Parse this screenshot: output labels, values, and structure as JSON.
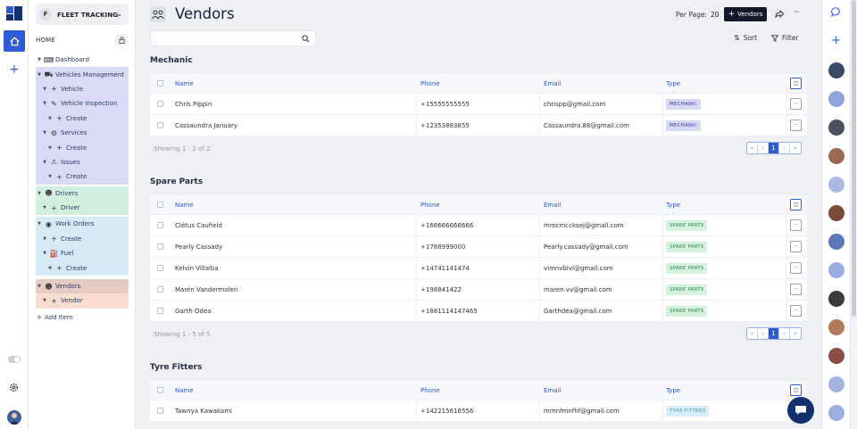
{
  "app": {
    "badge": "F",
    "name": "FLEET TRACKING"
  },
  "nav": {
    "home_label": "HOME",
    "items": [
      {
        "label": "Dashboard"
      },
      {
        "label": "Vehicles Management"
      },
      {
        "label": "Vehicle"
      },
      {
        "label": "Vehicle Inspection"
      },
      {
        "label": "Create"
      },
      {
        "label": "Services"
      },
      {
        "label": "Create"
      },
      {
        "label": "Issues"
      },
      {
        "label": "Create"
      },
      {
        "label": "Drivers"
      },
      {
        "label": "Driver"
      },
      {
        "label": "Work Orders"
      },
      {
        "label": "Create"
      },
      {
        "label": "Fuel"
      },
      {
        "label": "Create"
      },
      {
        "label": "Vendors"
      },
      {
        "label": "Vendor"
      },
      {
        "label": "Add Item"
      }
    ]
  },
  "header": {
    "title": "Vendors",
    "per_page_label": "Per Page:",
    "per_page_value": "20",
    "add_label": "Vendors",
    "sort_label": "Sort",
    "filter_label": "Filter",
    "search_placeholder": ""
  },
  "columns": {
    "name": "Name",
    "phone": "Phone",
    "email": "Email",
    "type": "Type"
  },
  "sections": [
    {
      "title": "Mechanic",
      "footer": "Showing 1 - 2 of 2",
      "page": "1",
      "rows": [
        {
          "name": "Chris Pippin",
          "phone": "+15555555555",
          "email": "chrispp@gmail.com",
          "type": "MECHANIC"
        },
        {
          "name": "Cassaundra January",
          "phone": "+12353883855",
          "email": "Cassaundra.88@gmail.com",
          "type": "MECHANIC"
        }
      ]
    },
    {
      "title": "Spare Parts",
      "footer": "Showing 1 - 5 of 5",
      "page": "1",
      "rows": [
        {
          "name": "Clétus Caufield",
          "phone": "+166666666666",
          "email": "mmcmccksej@gmail.com",
          "type": "SPARE PARTS"
        },
        {
          "name": "Pearly Cassady",
          "phone": "+1788999000",
          "email": "Pearly.cassady@gmail.com",
          "type": "SPARE PARTS"
        },
        {
          "name": "Kelvin Villalba",
          "phone": "+14741141474",
          "email": "vimnvbivl@gmail.com",
          "type": "SPARE PARTS"
        },
        {
          "name": "Maren Vandermolen",
          "phone": "+198841422",
          "email": "maren.vv@gmail.com",
          "type": "SPARE PARTS"
        },
        {
          "name": "Garth Odea",
          "phone": "+1881114147465",
          "email": "Garthdea@gmail.com",
          "type": "SPARE PARTS"
        }
      ]
    },
    {
      "title": "Tyre Fitters",
      "rows": [
        {
          "name": "Tawnya Kawakami",
          "phone": "+142215616556",
          "email": "mmnfmnfhf@gmail.com",
          "type": "TYRE FITTERS"
        }
      ]
    }
  ],
  "colors": {
    "accent": "#2f5bd4",
    "dark_button": "#14182b",
    "mechanic_tag": "#d7d9f5",
    "spare_tag": "#d5f2de",
    "tyre_tag": "#d7eef8"
  }
}
